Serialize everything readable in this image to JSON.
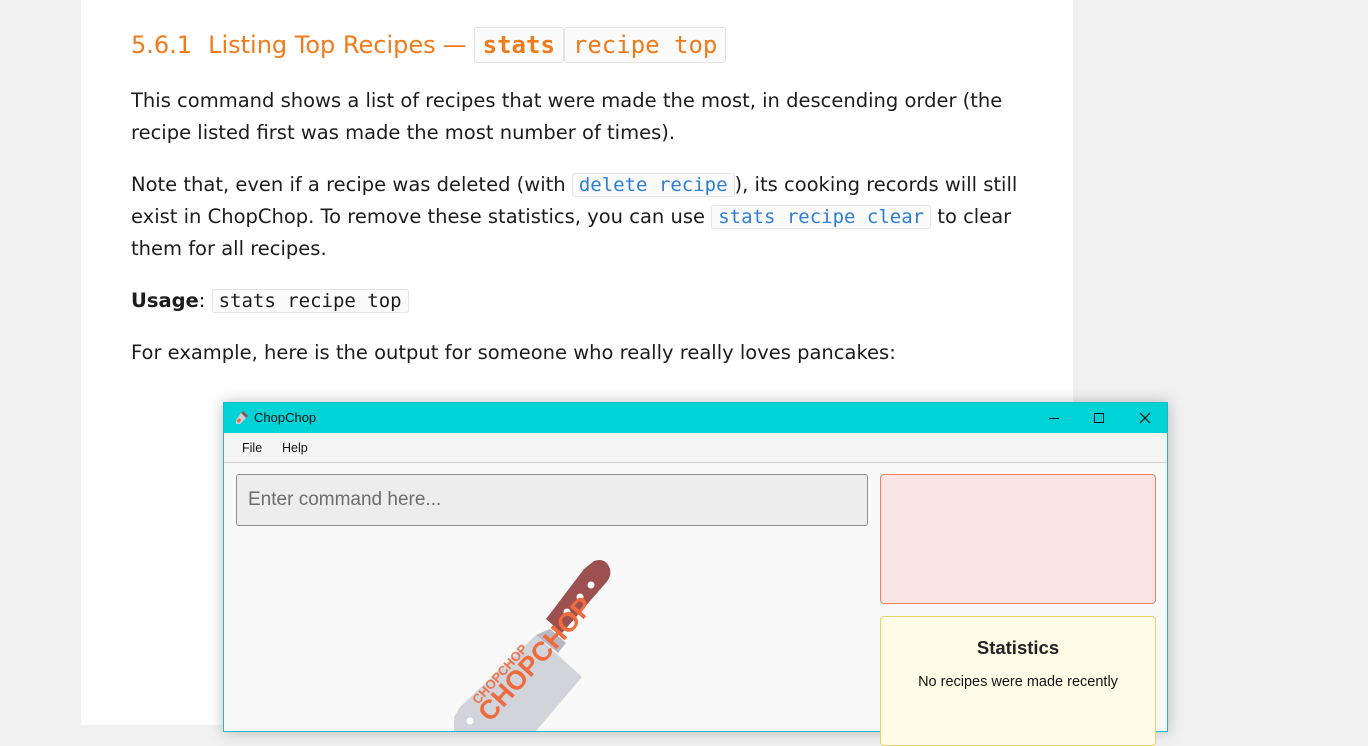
{
  "doc": {
    "heading": {
      "number": "5.6.1",
      "title": "Listing Top Recipes",
      "dash": "—",
      "code_part1": "stats",
      "code_part2": "recipe top"
    },
    "para1": "This command shows a list of recipes that were made the most, in descending order (the recipe listed first was made the most number of times).",
    "para2": {
      "text1": "Note that, even if a recipe was deleted (with ",
      "code1": "delete recipe",
      "text2": "), its cooking records will still exist in ChopChop. To remove these statistics, you can use ",
      "code2": "stats recipe clear",
      "text3": " to clear them for all recipes."
    },
    "usage": {
      "label": "Usage",
      "colon": ": ",
      "code": "stats recipe top"
    },
    "para3": "For example, here is the output for someone who really really loves pancakes:"
  },
  "app": {
    "title": "ChopChop",
    "controls": {
      "minimize": "—",
      "maximize": "☐",
      "close": "✕"
    },
    "menu": [
      "File",
      "Help"
    ],
    "command_placeholder": "Enter command here...",
    "logo_text": "CHOPCHOP",
    "stats": {
      "title": "Statistics",
      "message": "No recipes were made recently"
    }
  },
  "colors": {
    "heading": "#f07b1a",
    "inline_code": "#2b7fd6",
    "titlebar": "#00d3d6",
    "result_bg": "#fbe5e3",
    "stats_bg": "#fffde8",
    "knife_handle": "#9c5150",
    "knife_blade": "#d2d4dc",
    "logo_text": "#ef6b3c"
  },
  "icons": [
    "cleaver-icon",
    "minimize-icon",
    "maximize-icon",
    "close-icon"
  ]
}
